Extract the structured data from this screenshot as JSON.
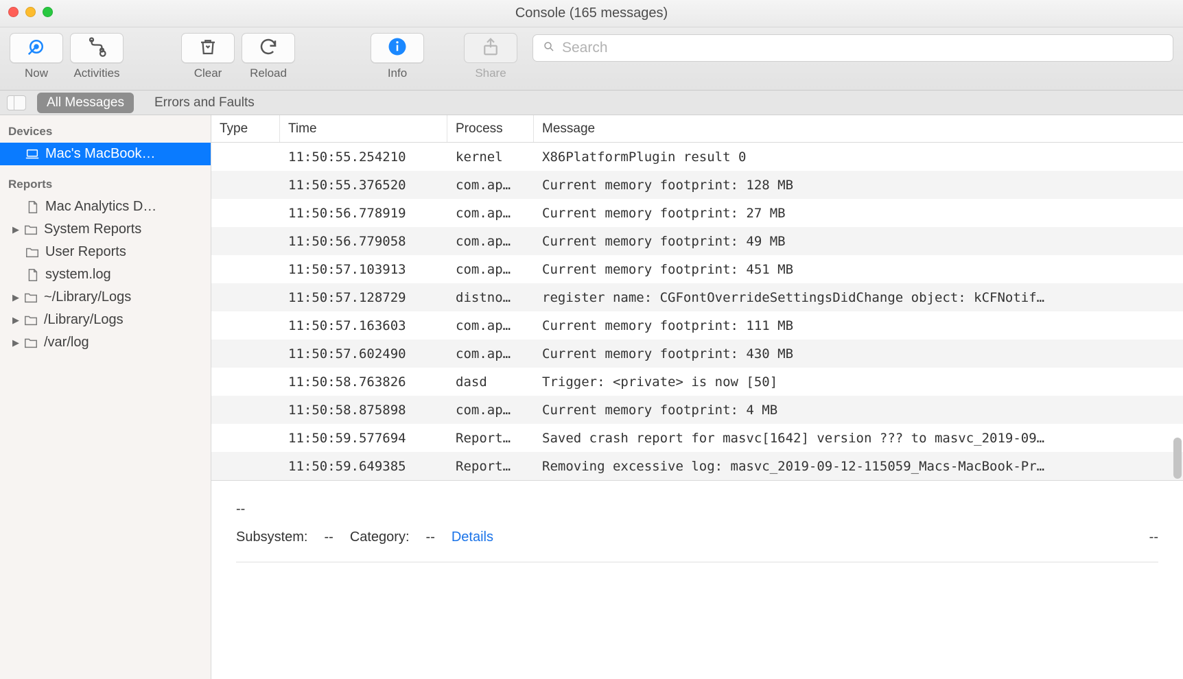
{
  "window": {
    "title": "Console (165 messages)"
  },
  "toolbar": {
    "now": "Now",
    "activities": "Activities",
    "clear": "Clear",
    "reload": "Reload",
    "info": "Info",
    "share": "Share",
    "search_placeholder": "Search"
  },
  "filter": {
    "all": "All Messages",
    "errors": "Errors and Faults"
  },
  "sidebar": {
    "devices_header": "Devices",
    "device": "Mac's MacBook…",
    "reports_header": "Reports",
    "items": [
      {
        "label": "Mac Analytics D…",
        "icon": "doc",
        "disclosure": false
      },
      {
        "label": "System Reports",
        "icon": "folder",
        "disclosure": true
      },
      {
        "label": "User Reports",
        "icon": "folder",
        "disclosure": false
      },
      {
        "label": "system.log",
        "icon": "doc",
        "disclosure": false
      },
      {
        "label": "~/Library/Logs",
        "icon": "folder",
        "disclosure": true
      },
      {
        "label": "/Library/Logs",
        "icon": "folder",
        "disclosure": true
      },
      {
        "label": "/var/log",
        "icon": "folder",
        "disclosure": true
      }
    ]
  },
  "table": {
    "headers": {
      "type": "Type",
      "time": "Time",
      "process": "Process",
      "message": "Message"
    },
    "rows": [
      {
        "time": "11:50:55.254210",
        "process": "kernel",
        "message": "X86PlatformPlugin result 0"
      },
      {
        "time": "11:50:55.376520",
        "process": "com.ap…",
        "message": "Current memory footprint: 128 MB"
      },
      {
        "time": "11:50:56.778919",
        "process": "com.ap…",
        "message": "Current memory footprint: 27 MB"
      },
      {
        "time": "11:50:56.779058",
        "process": "com.ap…",
        "message": "Current memory footprint: 49 MB"
      },
      {
        "time": "11:50:57.103913",
        "process": "com.ap…",
        "message": "Current memory footprint: 451 MB"
      },
      {
        "time": "11:50:57.128729",
        "process": "distno…",
        "message": "register name: CGFontOverrideSettingsDidChange object: kCFNotif…"
      },
      {
        "time": "11:50:57.163603",
        "process": "com.ap…",
        "message": "Current memory footprint: 111 MB"
      },
      {
        "time": "11:50:57.602490",
        "process": "com.ap…",
        "message": "Current memory footprint: 430 MB"
      },
      {
        "time": "11:50:58.763826",
        "process": "dasd",
        "message": "Trigger: <private> is now [50]"
      },
      {
        "time": "11:50:58.875898",
        "process": "com.ap…",
        "message": "Current memory footprint: 4 MB"
      },
      {
        "time": "11:50:59.577694",
        "process": "Report…",
        "message": "Saved crash report for masvc[1642] version ??? to masvc_2019-09…"
      },
      {
        "time": "11:50:59.649385",
        "process": "Report…",
        "message": "Removing excessive log: masvc_2019-09-12-115059_Macs-MacBook-Pr…"
      }
    ]
  },
  "detail": {
    "placeholder": "--",
    "subsystem_label": "Subsystem:",
    "subsystem_value": "--",
    "category_label": "Category:",
    "category_value": "--",
    "details_link": "Details",
    "right_value": "--"
  }
}
